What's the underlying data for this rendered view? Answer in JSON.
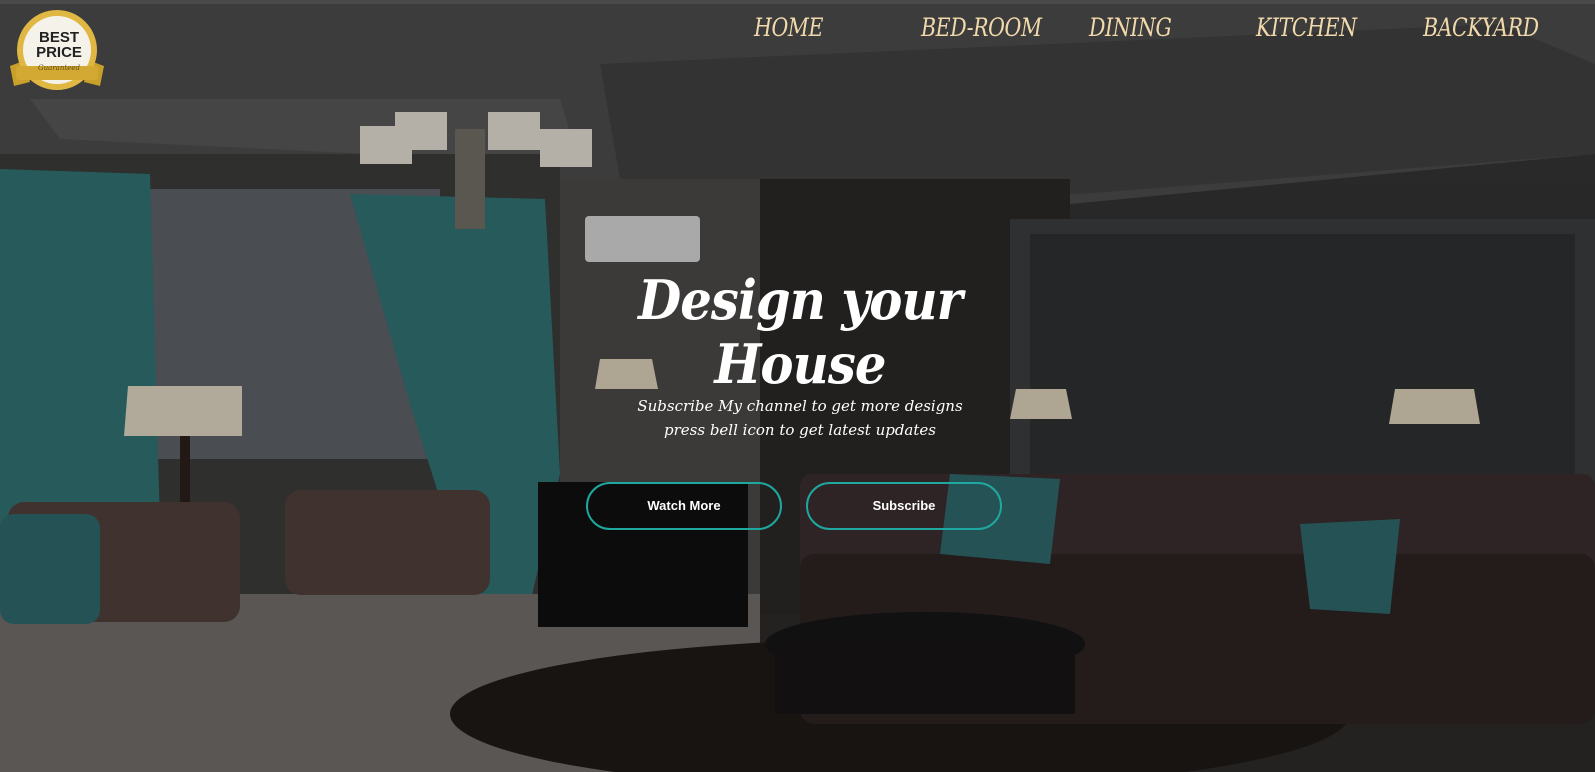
{
  "badge": {
    "line1": "BEST",
    "line2": "PRICE",
    "sub": "Guaranteed"
  },
  "nav": {
    "items": [
      {
        "label": "HOME"
      },
      {
        "label": "BED-ROOM"
      },
      {
        "label": "DINING"
      },
      {
        "label": "KITCHEN"
      },
      {
        "label": "BACKYARD"
      }
    ]
  },
  "hero": {
    "title": "Design your House",
    "subtitle_line1": "Subscribe My channel to get more designs",
    "subtitle_line2": "press bell icon to get latest updates"
  },
  "buttons": {
    "watch_more": "Watch More",
    "subscribe": "Subscribe"
  },
  "colors": {
    "nav_text": "#f1d9ab",
    "button_border": "#1fa8a0",
    "curtain": "#2f6e70"
  }
}
